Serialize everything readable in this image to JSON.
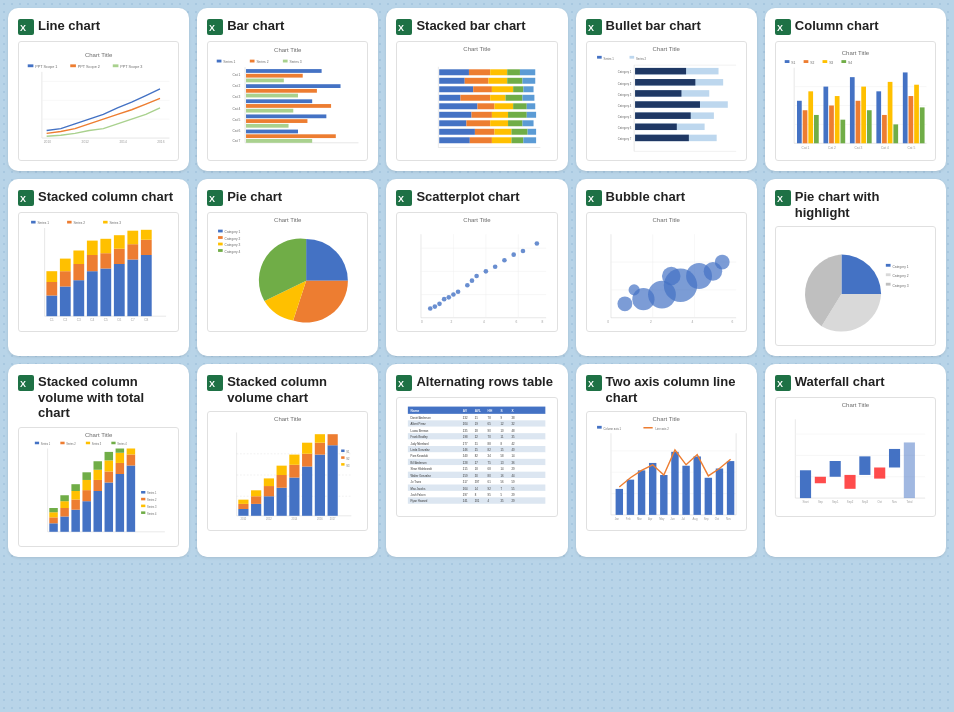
{
  "cards": [
    {
      "id": "line-chart",
      "title": "Line chart",
      "type": "line"
    },
    {
      "id": "bar-chart",
      "title": "Bar chart",
      "type": "bar"
    },
    {
      "id": "stacked-bar-chart",
      "title": "Stacked bar chart",
      "type": "stacked-bar"
    },
    {
      "id": "bullet-bar-chart",
      "title": "Bullet bar chart",
      "type": "bullet-bar"
    },
    {
      "id": "column-chart",
      "title": "Column chart",
      "type": "column"
    },
    {
      "id": "stacked-column-chart",
      "title": "Stacked column chart",
      "type": "stacked-column"
    },
    {
      "id": "pie-chart",
      "title": "Pie chart",
      "type": "pie"
    },
    {
      "id": "scatterplot-chart",
      "title": "Scatterplot chart",
      "type": "scatter"
    },
    {
      "id": "bubble-chart",
      "title": "Bubble chart",
      "type": "bubble"
    },
    {
      "id": "pie-chart-highlight",
      "title": "Pie chart with highlight",
      "type": "pie-highlight"
    },
    {
      "id": "stacked-column-volume-total",
      "title": "Stacked column volume with total chart",
      "type": "stacked-column-volume-total"
    },
    {
      "id": "stacked-column-volume",
      "title": "Stacked column volume chart",
      "type": "stacked-column-volume"
    },
    {
      "id": "alternating-rows-table",
      "title": "Alternating rows table",
      "type": "table"
    },
    {
      "id": "two-axis-column-line",
      "title": "Two axis column line chart",
      "type": "two-axis"
    },
    {
      "id": "waterfall-chart",
      "title": "Waterfall chart",
      "type": "waterfall"
    }
  ]
}
